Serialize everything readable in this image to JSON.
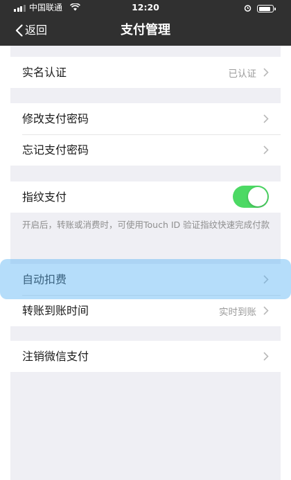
{
  "status_bar": {
    "carrier": "中国联通",
    "time": "12:20",
    "battery_level": 0.85,
    "icons": [
      "signal-icon",
      "wifi-icon",
      "alarm-icon",
      "battery-icon"
    ]
  },
  "nav": {
    "back_label": "返回",
    "title": "支付管理"
  },
  "groups": {
    "realname": {
      "label": "实名认证",
      "value": "已认证"
    },
    "change_password": {
      "label": "修改支付密码"
    },
    "forgot_password": {
      "label": "忘记支付密码"
    },
    "fingerprint": {
      "label": "指纹支付",
      "enabled": true,
      "note": "开启后，转账或消费时，可使用Touch ID 验证指纹快速完成付款"
    },
    "auto_deduct": {
      "label": "自动扣费"
    },
    "transfer_time": {
      "label": "转账到账时间",
      "value": "实时到账"
    },
    "cancel": {
      "label": "注销微信支付"
    }
  },
  "colors": {
    "header": "#303030",
    "toggle_on": "#4cd964",
    "background": "#efeff4",
    "highlight": "#5ab4f5"
  }
}
